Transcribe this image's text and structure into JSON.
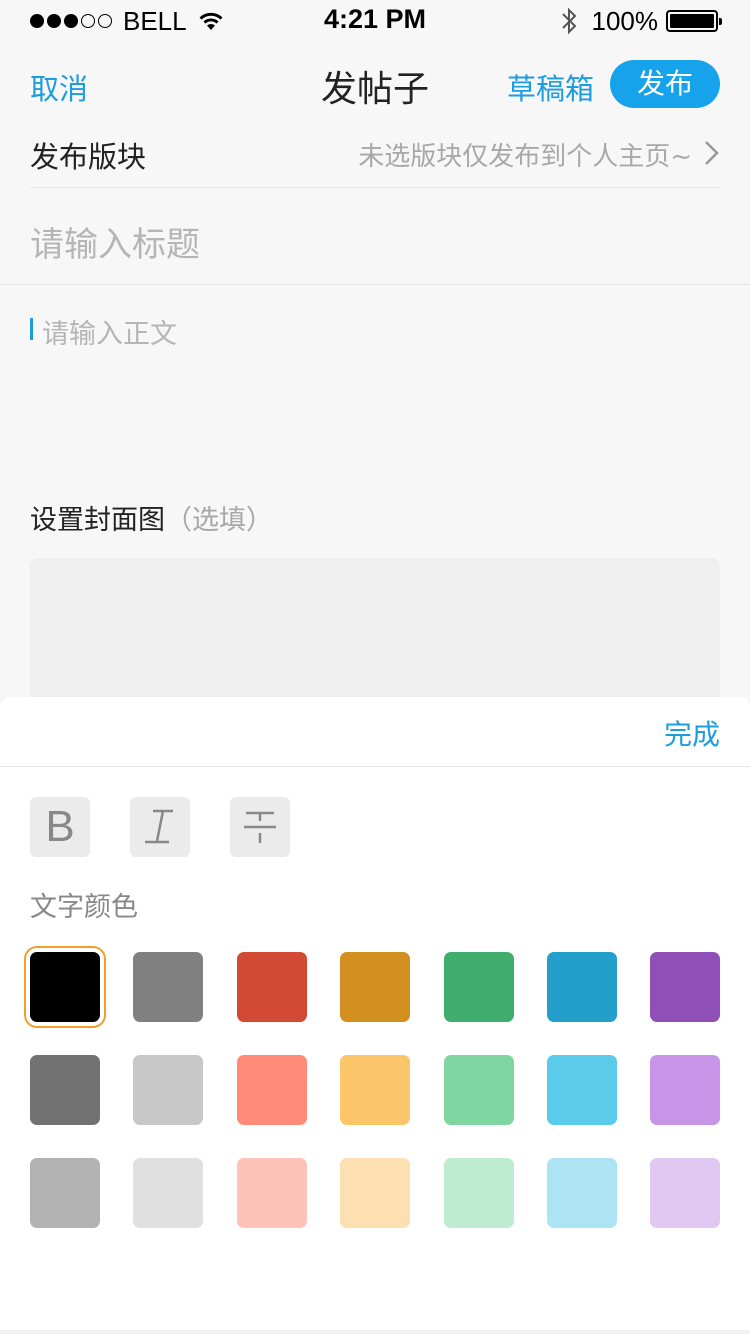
{
  "status_bar": {
    "carrier": "BELL",
    "time": "4:21 PM",
    "battery": "100%"
  },
  "nav": {
    "cancel": "取消",
    "title": "发帖子",
    "drafts": "草稿箱",
    "publish": "发布"
  },
  "board": {
    "label": "发布版块",
    "value": "未选版块仅发布到个人主页~"
  },
  "title_input": {
    "placeholder": "请输入标题"
  },
  "body_input": {
    "placeholder": "请输入正文"
  },
  "cover": {
    "label": "设置封面图",
    "optional": "（选填）"
  },
  "panel": {
    "done": "完成",
    "format_buttons": [
      {
        "label": "B",
        "icon": "bold-icon"
      },
      {
        "label": "I",
        "icon": "italic-icon"
      },
      {
        "label": "",
        "icon": "strikethrough-icon"
      }
    ],
    "color_label": "文字颜色",
    "selected_color": "#000000",
    "colors": [
      [
        "#000000",
        "#808080",
        "#d24a36",
        "#d48f21",
        "#41ad6d",
        "#229fca",
        "#904fb6"
      ],
      [
        "#727272",
        "#c8c8c8",
        "#ff8a78",
        "#fbc56a",
        "#7fd6a0",
        "#5bcbea",
        "#c894e8"
      ],
      [
        "#b2b2b2",
        "#e0e0e0",
        "#fdc2b8",
        "#fde0b1",
        "#bdecd0",
        "#ade4f3",
        "#e0c8f2"
      ]
    ]
  }
}
